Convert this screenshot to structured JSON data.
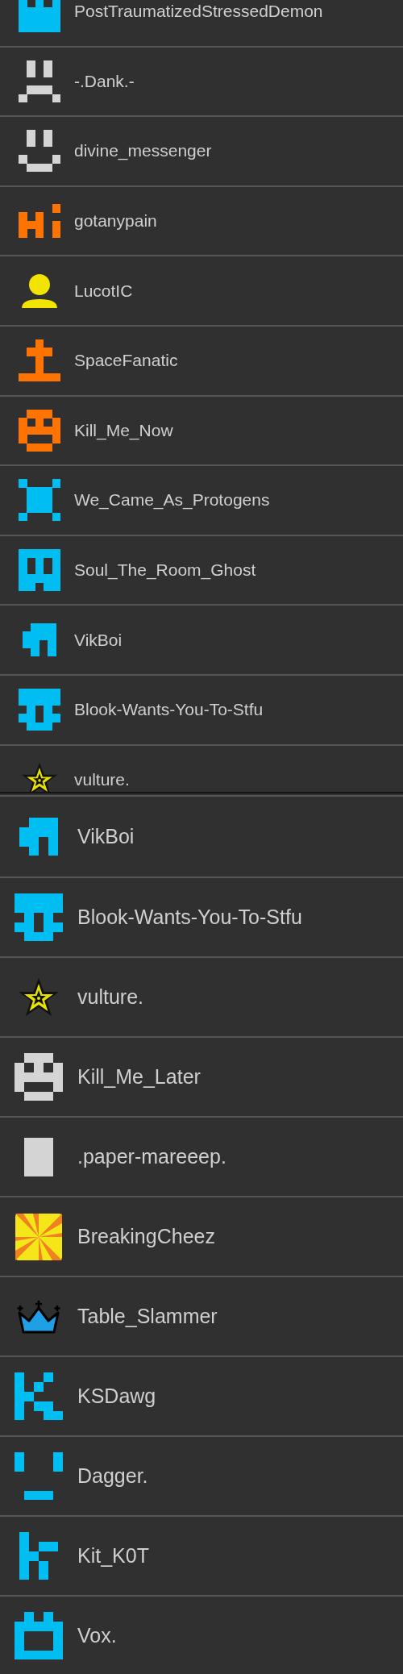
{
  "panels": [
    {
      "rows": [
        {
          "name": "PostTraumatizedStressedDemon",
          "avatar": {
            "kind": "tower",
            "color": "#00bef2"
          }
        },
        {
          "name": "-.Dank.-",
          "avatar": {
            "kind": "frown",
            "color": "#d4d4d4"
          }
        },
        {
          "name": "divine_messenger",
          "avatar": {
            "kind": "smile",
            "color": "#d4d4d4"
          }
        },
        {
          "name": "gotanypain",
          "avatar": {
            "kind": "hi",
            "color": "#ff7400"
          }
        },
        {
          "name": "LucotIC",
          "avatar": {
            "kind": "person",
            "color": "#f2e400"
          }
        },
        {
          "name": "SpaceFanatic",
          "avatar": {
            "kind": "cross",
            "color": "#ff7400"
          }
        },
        {
          "name": "Kill_Me_Now",
          "avatar": {
            "kind": "robot",
            "color": "#ff7400"
          }
        },
        {
          "name": "We_Came_As_Protogens",
          "avatar": {
            "kind": "x",
            "color": "#00bef2"
          }
        },
        {
          "name": "Soul_The_Room_Ghost",
          "avatar": {
            "kind": "ghost",
            "color": "#00bef2"
          }
        },
        {
          "name": "VikBoi",
          "avatar": {
            "kind": "vik",
            "color": "#00bef2"
          }
        },
        {
          "name": "Blook-Wants-You-To-Stfu",
          "avatar": {
            "kind": "blook",
            "color": "#00bef2"
          }
        },
        {
          "name": "vulture.",
          "avatar": {
            "kind": "star"
          }
        }
      ]
    },
    {
      "rows": [
        {
          "name": "VikBoi",
          "avatar": {
            "kind": "vik",
            "color": "#00bef2"
          }
        },
        {
          "name": "Blook-Wants-You-To-Stfu",
          "avatar": {
            "kind": "blook",
            "color": "#00bef2"
          }
        },
        {
          "name": "vulture.",
          "avatar": {
            "kind": "star"
          }
        },
        {
          "name": "Kill_Me_Later",
          "avatar": {
            "kind": "robot",
            "color": "#d4d4d4"
          }
        },
        {
          "name": ".paper-mareeep.",
          "avatar": {
            "kind": "paper",
            "color": "#d4d4d4"
          }
        },
        {
          "name": "BreakingCheez",
          "avatar": {
            "kind": "pinwheel"
          }
        },
        {
          "name": "Table_Slammer",
          "avatar": {
            "kind": "crown"
          }
        },
        {
          "name": "KSDawg",
          "avatar": {
            "kind": "k",
            "color": "#00bef2"
          }
        },
        {
          "name": "Dagger.",
          "avatar": {
            "kind": "dagger",
            "color": "#00bef2"
          }
        },
        {
          "name": "Kit_K0T",
          "avatar": {
            "kind": "kit",
            "color": "#00bef2"
          }
        },
        {
          "name": "Vox.",
          "avatar": {
            "kind": "vox",
            "color": "#00bef2"
          }
        }
      ]
    }
  ]
}
